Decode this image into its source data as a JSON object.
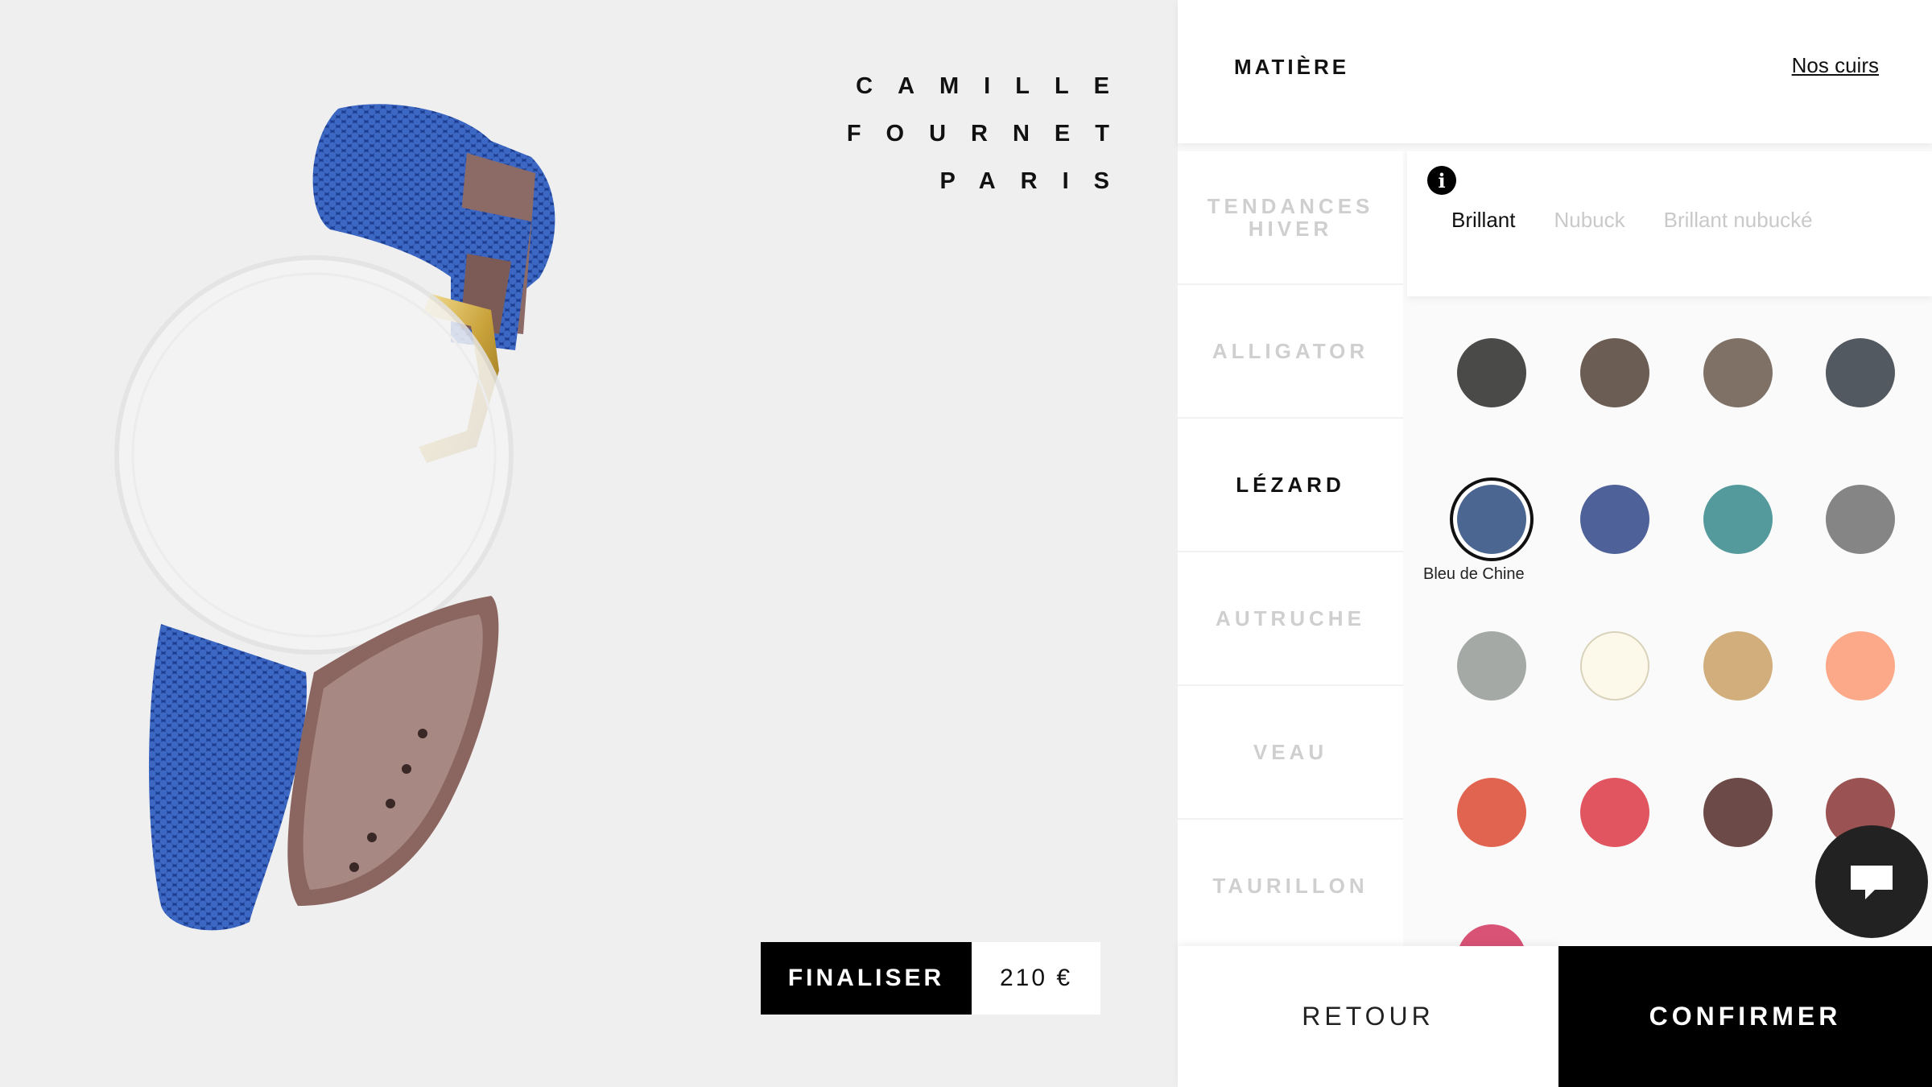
{
  "brand": {
    "line1": "CAMILLE",
    "line2": "FOURNET",
    "line3": "PARIS"
  },
  "finalize": {
    "label": "FINALISER",
    "price": "210 €"
  },
  "panel": {
    "title": "MATIÈRE",
    "link": "Nos cuirs",
    "categories": [
      {
        "label": "TENDANCES HIVER",
        "active": false
      },
      {
        "label": "ALLIGATOR",
        "active": false
      },
      {
        "label": "LÉZARD",
        "active": true
      },
      {
        "label": "AUTRUCHE",
        "active": false
      },
      {
        "label": "VEAU",
        "active": false
      },
      {
        "label": "TAURILLON",
        "active": false
      }
    ],
    "info_icon": "i",
    "finishes": [
      {
        "label": "Brillant",
        "active": true
      },
      {
        "label": "Nubuck",
        "active": false
      },
      {
        "label": "Brillant nubucké",
        "active": false
      }
    ],
    "selected_color_name": "Bleu de Chine",
    "swatch_colors": [
      "#4a4a48",
      "#6b5d53",
      "#7f7166",
      "#535961",
      "#4b6690",
      "#4e6299",
      "#549a9c",
      "#858585",
      "#a4a9a6",
      "#fdf9ea",
      "#d1ae7b",
      "#fca98a",
      "#e06450",
      "#e05560",
      "#6c4a47",
      "#9b5252",
      "#d95377"
    ],
    "selected_index": 4
  },
  "footer": {
    "back": "RETOUR",
    "confirm": "CONFIRMER"
  }
}
